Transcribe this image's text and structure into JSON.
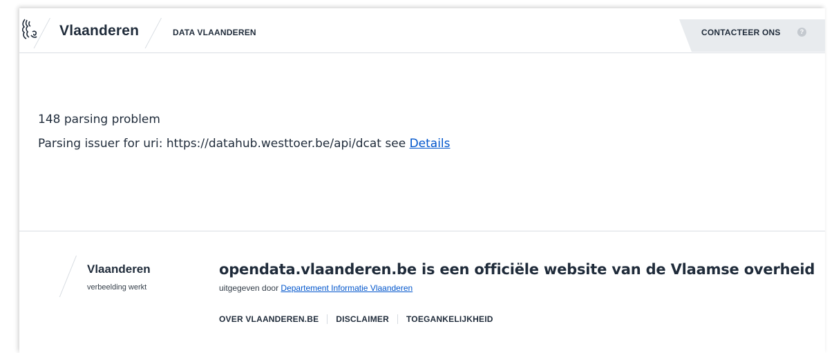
{
  "header": {
    "brand": "Vlaanderen",
    "site_title": "DATA VLAANDEREN",
    "contact_label": "CONTACTEER ONS",
    "help_icon": "?",
    "logo_icon": "flemish-lion-icon"
  },
  "main": {
    "message_title": "148 parsing problem",
    "message_text": "Parsing issuer for uri: https://datahub.westtoer.be/api/dcat see",
    "details_link": "Details"
  },
  "footer": {
    "brand": "Vlaanderen",
    "tagline": "verbeelding werkt",
    "heading": "opendata.vlaanderen.be is een officiële website van de Vlaamse overheid",
    "publisher_prefix": "uitgegeven door",
    "publisher_link": "Departement Informatie Vlaanderen",
    "links": [
      "OVER VLAANDEREN.BE",
      "DISCLAIMER",
      "TOEGANKELIJKHEID"
    ]
  },
  "colors": {
    "text": "#1f2b3a",
    "link": "#0055cc",
    "contact_bg": "#e8ebee",
    "divider": "#d9dde2"
  }
}
